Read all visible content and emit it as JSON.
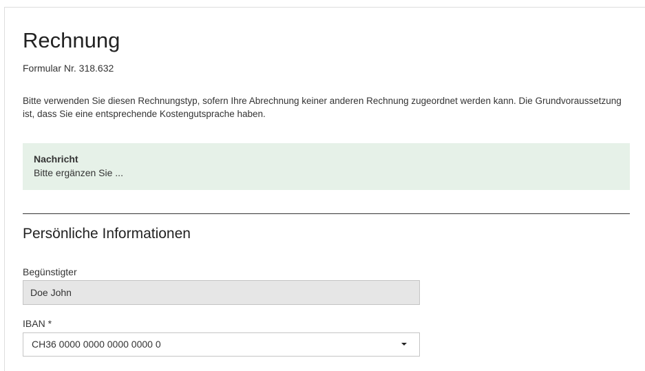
{
  "page": {
    "title": "Rechnung",
    "form_number": "Formular Nr. 318.632",
    "description": "Bitte verwenden Sie diesen Rechnungstyp, sofern Ihre Abrechnung keiner anderen Rechnung zugeordnet werden kann. Die Grundvoraussetzung ist, dass Sie eine entsprechende Kostengutsprache haben."
  },
  "message": {
    "title": "Nachricht",
    "text": "Bitte ergänzen Sie ...",
    "background_color": "#e6f1e8"
  },
  "section": {
    "title": "Persönliche Informationen"
  },
  "fields": {
    "beneficiary": {
      "label": "Begünstigter",
      "value": "Doe John"
    },
    "iban": {
      "label": "IBAN *",
      "value": "CH36 0000 0000 0000 0000 0",
      "icon": "caret-down-icon"
    }
  }
}
